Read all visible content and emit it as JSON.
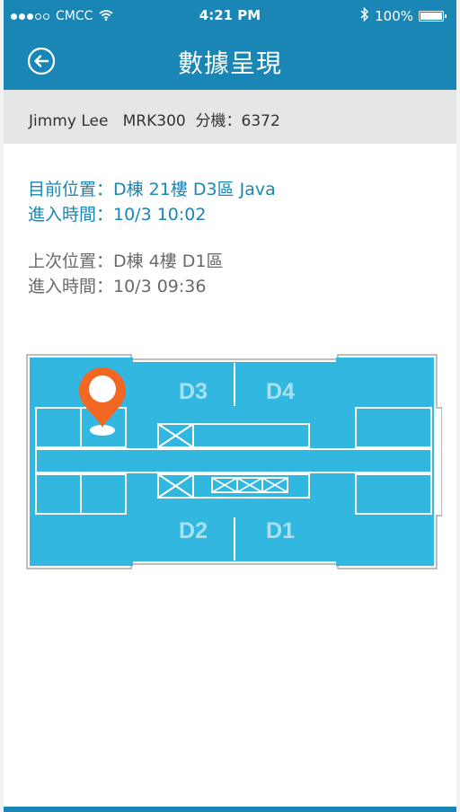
{
  "status_bar": {
    "carrier": "CMCC",
    "time": "4:21 PM",
    "battery": "100%"
  },
  "nav": {
    "title": "數據呈現"
  },
  "user": {
    "info": "Jimmy Lee   MRK300  分機：6372"
  },
  "current_location": {
    "position": "目前位置：D棟 21樓  D3區 Java",
    "entry_time": "進入時間：10/3  10:02"
  },
  "last_location": {
    "position": "上次位置：D棟 4樓  D1區",
    "entry_time": "進入時間：10/3  09:36"
  },
  "floor_map": {
    "zones": [
      "D3",
      "D4",
      "D2",
      "D1"
    ],
    "marker_zone": "D3"
  },
  "colors": {
    "brand": "#1a86b5",
    "map_fill": "#31b7e0",
    "marker": "#f26722"
  }
}
